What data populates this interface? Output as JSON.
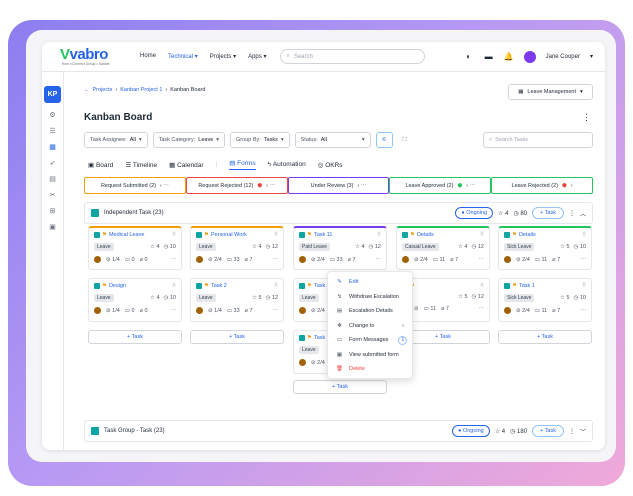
{
  "brand": {
    "name": "vabro",
    "tagline": "from vConnect Group • Sanket"
  },
  "nav": [
    "Home",
    "Technical",
    "Projects",
    "Apps"
  ],
  "search_placeholder": "Search",
  "user": "Jane Cooper",
  "sidebar_badge": "KP",
  "breadcrumb": [
    "Projects",
    "Kanban Project 1",
    "Kanban Board"
  ],
  "leave_mgmt": "Leave Management",
  "page_title": "Kanban Board",
  "filters": [
    {
      "label": "Task Assignee:",
      "value": "All"
    },
    {
      "label": "Task Category:",
      "value": "Leave"
    },
    {
      "label": "Group By:",
      "value": "Tasks"
    },
    {
      "label": "Status:",
      "value": "All"
    }
  ],
  "search_tasks": "Search Tasks",
  "tabs": [
    "Board",
    "Timeline",
    "Calendar",
    "Forms",
    "Automation",
    "OKRs"
  ],
  "statuses": [
    {
      "label": "Request Submitted (2)",
      "color": "#f59e0b"
    },
    {
      "label": "Request Rejected (12)",
      "color": "#ef4444"
    },
    {
      "label": "Under Review (3)",
      "color": "#7c3aed"
    },
    {
      "label": "Leave Approved (2)",
      "color": "#22c55e"
    },
    {
      "label": "Leave Rejected (2)",
      "color": "#22c55e"
    }
  ],
  "group1": {
    "name": "Independent Task (23)",
    "status": "Ongoing",
    "stars": "4",
    "time": "80",
    "add": "+ Task"
  },
  "group2": {
    "name": "Task Group - Task (23)",
    "status": "Ongoing",
    "stars": "4",
    "time": "180",
    "add": "+ Task"
  },
  "cards": [
    {
      "title": "Medical Leave",
      "tag": "Leave",
      "s": "4",
      "t": "10",
      "sub": "1/4",
      "c": "0",
      "a": "0"
    },
    {
      "title": "Personal Work",
      "tag": "Leave",
      "s": "4",
      "t": "12",
      "sub": "2/4",
      "c": "33",
      "a": "7"
    },
    {
      "title": "Task 11",
      "tag": "Paid Leave",
      "s": "4",
      "t": "12",
      "sub": "2/4",
      "c": "33",
      "a": "7"
    },
    {
      "title": "Details",
      "tag": "Casual Leave",
      "s": "4",
      "t": "12",
      "sub": "2/4",
      "c": "11",
      "a": "7"
    },
    {
      "title": "Details",
      "tag": "Sick Leave",
      "s": "5",
      "t": "10",
      "sub": "2/4",
      "c": "11",
      "a": "7"
    },
    {
      "title": "Design",
      "tag": "Leave",
      "s": "4",
      "t": "10",
      "sub": "1/4",
      "c": "0",
      "a": "0"
    },
    {
      "title": "Task 2",
      "tag": "Leave",
      "s": "5",
      "t": "12",
      "sub": "1/4",
      "c": "33",
      "a": "7"
    },
    {
      "title": "Task 12",
      "tag": "Leave",
      "s": "4",
      "t": "",
      "sub": "2/4",
      "c": "33",
      "a": "7"
    },
    {
      "title": "",
      "tag": "",
      "s": "5",
      "t": "12",
      "sub": "",
      "c": "11",
      "a": "7"
    },
    {
      "title": "Task 1",
      "tag": "Sick Leave",
      "s": "5",
      "t": "10",
      "sub": "2/4",
      "c": "11",
      "a": "7"
    },
    {
      "title": "Task 13",
      "tag": "Leave",
      "s": "4",
      "t": "",
      "sub": "2/4",
      "c": "33",
      "a": "7"
    }
  ],
  "add_task": "+ Task",
  "menu": [
    "Edit",
    "Withdraw Escalation",
    "Escalation Details",
    "Change to",
    "Form Messages",
    "View submitted form",
    "Delete"
  ],
  "menu_count": "1"
}
